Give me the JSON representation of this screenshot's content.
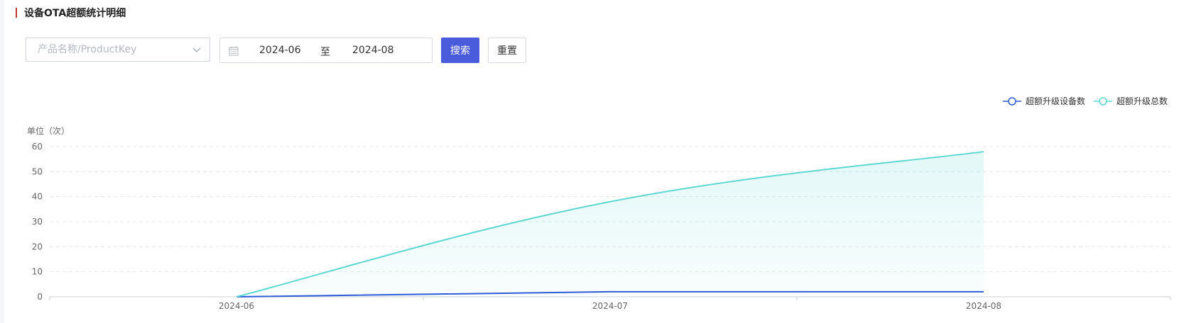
{
  "header": {
    "title": "设备OTA超额统计明细"
  },
  "filters": {
    "product_placeholder": "产品名称/ProductKey",
    "date_start": "2024-06",
    "date_separator": "至",
    "date_end": "2024-08",
    "search_label": "搜索",
    "reset_label": "重置"
  },
  "colors": {
    "accent": "#4a5bdc",
    "title_bar": "#c0392b",
    "series1": "#2f5bd7",
    "series2": "#5fd8d2"
  },
  "chart_data": {
    "type": "line",
    "unit_label": "单位（次）",
    "categories": [
      "2024-06",
      "2024-07",
      "2024-08"
    ],
    "ylim": [
      0,
      60
    ],
    "yticks": [
      0,
      10,
      20,
      30,
      40,
      50,
      60
    ],
    "grid": true,
    "legend_position": "top-right",
    "series": [
      {
        "name": "超额升级设备数",
        "values": [
          0,
          2,
          2
        ],
        "color": "#2f5bd7",
        "area": false
      },
      {
        "name": "超额升级总数",
        "values": [
          0,
          38,
          58
        ],
        "color": "#5fd8d2",
        "area": true
      }
    ]
  }
}
